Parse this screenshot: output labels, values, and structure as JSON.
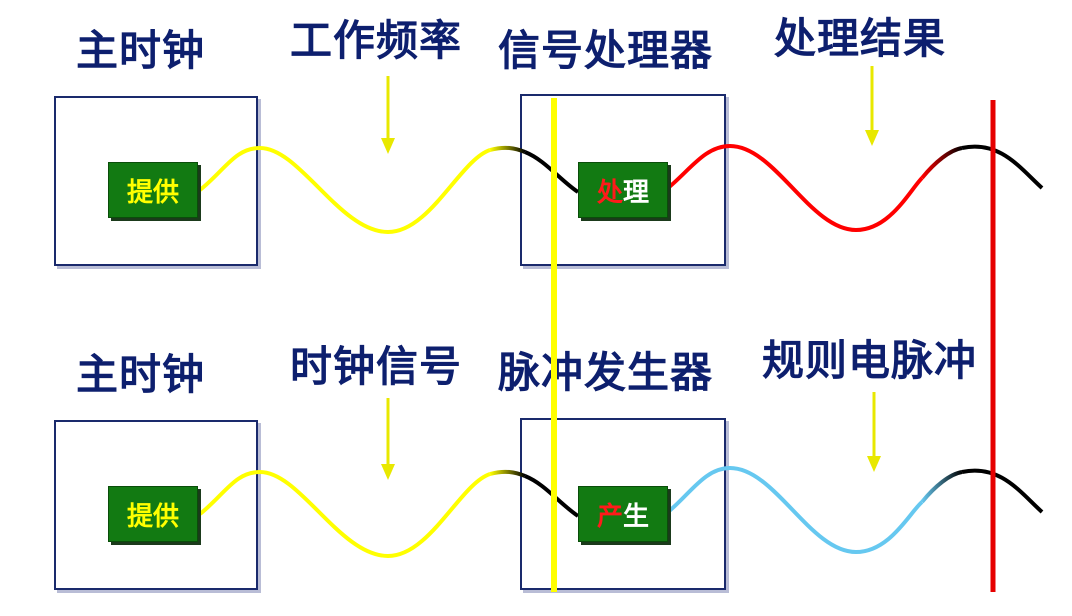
{
  "top_row": {
    "labels": [
      "主时钟",
      "工作频率",
      "信号处理器",
      "处理结果"
    ],
    "left_button": "提供",
    "right_button": [
      "处",
      "理"
    ]
  },
  "bottom_row": {
    "labels": [
      "主时钟",
      "时钟信号",
      "脉冲发生器",
      "规则电脉冲"
    ],
    "left_button": "提供",
    "right_button": [
      "产",
      "生"
    ]
  },
  "colors": {
    "label_text": "#0d1f6e",
    "box_border": "#1a2a6c",
    "button_bg": "#127a12",
    "button_text": "#ffff00",
    "wave_input": "#ffff00",
    "wave_top_output": "#ff0000",
    "wave_bottom_output": "#66c8f0",
    "wave_tail": "#000000",
    "divider_yellow": "#ffff00",
    "divider_red": "#e60000"
  }
}
